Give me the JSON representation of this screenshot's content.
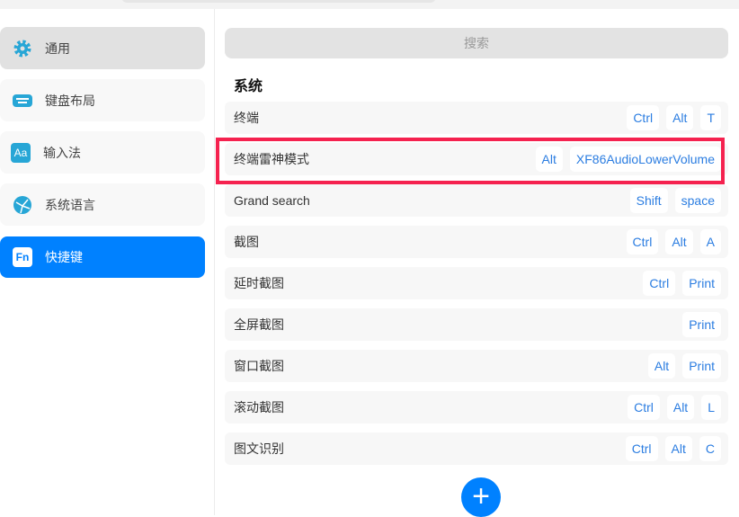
{
  "sidebar": {
    "items": [
      {
        "label": "通用",
        "icon": "gear-icon"
      },
      {
        "label": "键盘布局",
        "icon": "keyboard-icon"
      },
      {
        "label": "输入法",
        "icon": "input-method-icon"
      },
      {
        "label": "系统语言",
        "icon": "globe-icon"
      },
      {
        "label": "快捷键",
        "icon": "fn-icon"
      }
    ],
    "input_icon_text": "Aa",
    "fn_icon_text": "Fn"
  },
  "main": {
    "search_placeholder": "搜索",
    "section_title": "系统",
    "rows": [
      {
        "name": "终端",
        "keys": [
          "Ctrl",
          "Alt",
          "T"
        ]
      },
      {
        "name": "终端雷神模式",
        "keys": [
          "Alt",
          "XF86AudioLowerVolume"
        ]
      },
      {
        "name": "Grand search",
        "keys": [
          "Shift",
          "space"
        ]
      },
      {
        "name": "截图",
        "keys": [
          "Ctrl",
          "Alt",
          "A"
        ]
      },
      {
        "name": "延时截图",
        "keys": [
          "Ctrl",
          "Print"
        ]
      },
      {
        "name": "全屏截图",
        "keys": [
          "Print"
        ]
      },
      {
        "name": "窗口截图",
        "keys": [
          "Alt",
          "Print"
        ]
      },
      {
        "name": "滚动截图",
        "keys": [
          "Ctrl",
          "Alt",
          "L"
        ]
      },
      {
        "name": "图文识别",
        "keys": [
          "Ctrl",
          "Alt",
          "C"
        ]
      }
    ],
    "add_label": "+"
  },
  "colors": {
    "accent": "#0081ff",
    "highlight": "#f5224f",
    "key_text": "#2b7de1"
  }
}
